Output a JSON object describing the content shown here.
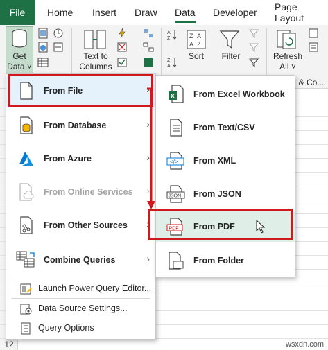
{
  "tabs": {
    "file": "File",
    "home": "Home",
    "insert": "Insert",
    "draw": "Draw",
    "data": "Data",
    "developer": "Developer",
    "page_layout": "Page Layout"
  },
  "ribbon": {
    "get_data_line1": "Get",
    "get_data_line2": "Data ˅",
    "text_to_columns_line1": "Text to",
    "text_to_columns_line2": "Columns",
    "sort": "Sort",
    "filter": "Filter",
    "refresh_line1": "Refresh",
    "refresh_line2": "All ˅",
    "queries_connections": "& Co..."
  },
  "get_data_menu": {
    "items": [
      {
        "label": "From File",
        "underline": "F",
        "icon": "file-icon",
        "submenu": true,
        "disabled": false
      },
      {
        "label": "From Database",
        "underline": "D",
        "icon": "database-icon",
        "submenu": true,
        "disabled": false
      },
      {
        "label": "From Azure",
        "underline": "A",
        "icon": "azure-icon",
        "submenu": true,
        "disabled": false
      },
      {
        "label": "From Online Services",
        "underline": "",
        "icon": "online-services-icon",
        "submenu": true,
        "disabled": true
      },
      {
        "label": "From Other Sources",
        "underline": "O",
        "icon": "other-sources-icon",
        "submenu": true,
        "disabled": false
      },
      {
        "label": "Combine Queries",
        "underline": "",
        "icon": "combine-queries-icon",
        "submenu": true,
        "disabled": false
      }
    ],
    "small_items": [
      {
        "label": "Launch Power Query Editor...",
        "icon": "power-query-editor-icon"
      },
      {
        "label": "Data Source Settings...",
        "icon": "data-source-settings-icon"
      },
      {
        "label": "Query Options",
        "icon": "query-options-icon"
      }
    ],
    "arrow_glyph": "›"
  },
  "from_file_submenu": {
    "items": [
      {
        "label": "From Excel Workbook",
        "icon": "excel-workbook-icon"
      },
      {
        "label": "From Text/CSV",
        "icon": "text-csv-icon"
      },
      {
        "label": "From XML",
        "icon": "xml-icon"
      },
      {
        "label": "From JSON",
        "icon": "json-icon"
      },
      {
        "label": "From PDF",
        "icon": "pdf-icon",
        "highlighted": true
      },
      {
        "label": "From Folder",
        "icon": "folder-icon"
      }
    ]
  },
  "icon_text": {
    "xml": "</>",
    "json": "JSON",
    "pdf": "PDF",
    "excel": "X"
  },
  "sheet": {
    "row_number": "12"
  },
  "watermark": "wsxdn.com",
  "colors": {
    "excel_green": "#1e7145",
    "highlight_red": "#d0191f",
    "azure_blue": "#0078d4",
    "menu_hover": "#e5f1fb"
  }
}
